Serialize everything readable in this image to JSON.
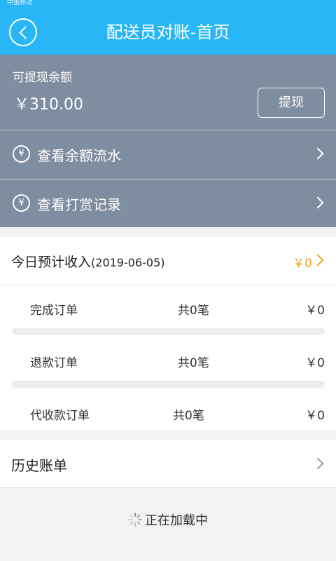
{
  "status_bar": {
    "carrier": "中国移动"
  },
  "header": {
    "title": "配送员对账-首页",
    "back_icon": "chevron-left-icon"
  },
  "balance": {
    "label": "可提现余额",
    "amount": "￥310.00",
    "withdraw_button": "提现"
  },
  "menu": [
    {
      "label": "查看余额流水",
      "icon": "yen-circle-icon"
    },
    {
      "label": "查看打赏记录",
      "icon": "yen-circle-icon"
    }
  ],
  "today": {
    "label": "今日预计收入",
    "date": "(2019-06-05)",
    "amount": "￥0"
  },
  "orders": [
    {
      "name": "完成订单",
      "count": "共0笔",
      "amount": "￥0"
    },
    {
      "name": "退款订单",
      "count": "共0笔",
      "amount": "￥0"
    },
    {
      "name": "代收款订单",
      "count": "共0笔",
      "amount": "￥0"
    }
  ],
  "history": {
    "label": "历史账单"
  },
  "loading": {
    "text": "正在加载中"
  },
  "colors": {
    "header": "#29b6f6",
    "panel": "#7f8da0",
    "accent": "#f0a020",
    "background": "#f2f2f2"
  }
}
